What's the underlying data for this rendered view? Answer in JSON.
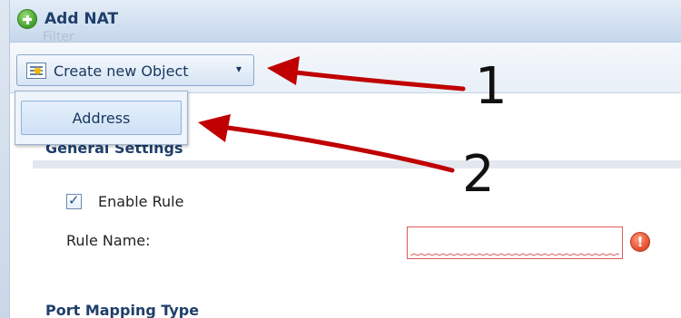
{
  "window": {
    "title": "Add NAT",
    "ghost_text": "Filter"
  },
  "toolbar": {
    "create_label": "Create new Object",
    "create_chevron": "▾"
  },
  "dropdown": {
    "items": [
      {
        "label": "Address"
      }
    ]
  },
  "general_settings": {
    "title": "General Settings",
    "enable_rule_label": "Enable Rule",
    "enable_rule_checked": true,
    "rule_name_label": "Rule Name:",
    "rule_name_value": "",
    "error_icon_glyph": "!"
  },
  "port_mapping": {
    "title": "Port Mapping Type"
  },
  "annotations": {
    "callout_1": "1",
    "callout_2": "2",
    "arrow_color": "#c00000"
  },
  "icons": [
    "add-circle-icon",
    "new-object-icon",
    "chevron-down-icon",
    "checkbox-check-icon",
    "error-icon"
  ]
}
